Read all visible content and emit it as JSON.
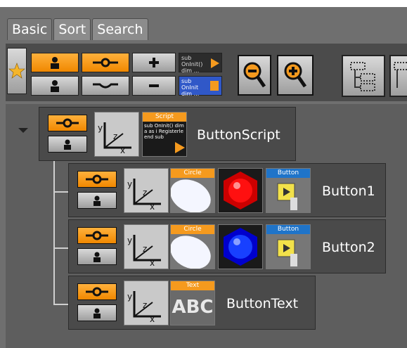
{
  "tabs": [
    {
      "label": "Basic",
      "active": true
    },
    {
      "label": "Sort",
      "active": false
    },
    {
      "label": "Search",
      "active": false
    }
  ],
  "toolbar": {
    "script_label": "sub OnInit() dim ...",
    "script_label2": "sub OnInit dim ..."
  },
  "tree": {
    "nodes": [
      {
        "name": "ButtonScript",
        "plugin_tag": "Script",
        "plugin_text": "sub OnInit() dim a as i Registerle end sub"
      },
      {
        "name": "Button1",
        "geom_tag": "Circle",
        "button_tag": "Button",
        "sphere_color": "#ff1010",
        "hex_color": "#cc0000"
      },
      {
        "name": "Button2",
        "geom_tag": "Circle",
        "button_tag": "Button",
        "sphere_color": "#1840ff",
        "hex_color": "#0000cc"
      },
      {
        "name": "ButtonText",
        "geom_tag": "Text",
        "text_sample": "ABC"
      }
    ]
  },
  "colors": {
    "orange": "#f59a1e",
    "blue_tag": "#1f74c9"
  },
  "icons": {
    "favorite": "star-icon",
    "zoom_out": "zoom-out-icon",
    "zoom_in": "zoom-in-icon"
  }
}
